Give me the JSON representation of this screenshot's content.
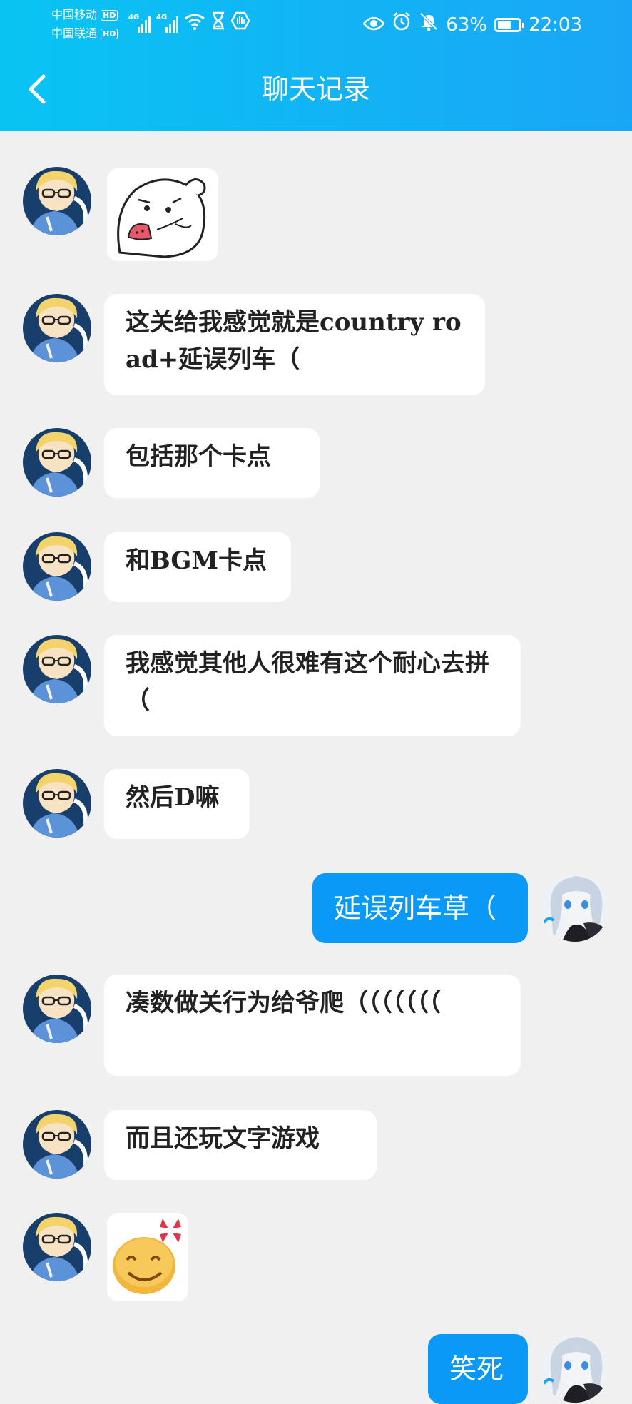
{
  "status_bar": {
    "carrier_1": "中国移动",
    "carrier_2": "中国联通",
    "hd_label": "HD",
    "network_1": "4G",
    "network_2": "4G",
    "battery_percent": "63%",
    "battery_level": 0.63,
    "time": "22:03"
  },
  "header": {
    "title": "聊天记录"
  },
  "colors": {
    "header_gradient_start": "#09c4f3",
    "header_gradient_end": "#1aa6f6",
    "outgoing_bubble": "#0a99f7",
    "incoming_bubble": "#ffffff",
    "background": "#f0f0f0"
  },
  "messages": [
    {
      "side": "incoming",
      "type": "sticker",
      "sticker": "white-blob-eating-watermelon-sticker"
    },
    {
      "side": "incoming",
      "type": "text",
      "text": "这关给我感觉就是country road+延误列车（"
    },
    {
      "side": "incoming",
      "type": "text",
      "text": "包括那个卡点"
    },
    {
      "side": "incoming",
      "type": "text",
      "text": "和BGM卡点"
    },
    {
      "side": "incoming",
      "type": "text",
      "text": "我感觉其他人很难有这个耐心去拼（"
    },
    {
      "side": "incoming",
      "type": "text",
      "text": "然后D嘛"
    },
    {
      "side": "outgoing",
      "type": "text",
      "text": "延误列车草（"
    },
    {
      "side": "incoming",
      "type": "text",
      "text": "凑数做关行为给爷爬（（（（（（（"
    },
    {
      "side": "incoming",
      "type": "text",
      "text": "而且还玩文字游戏"
    },
    {
      "side": "incoming",
      "type": "sticker",
      "sticker": "angry-smiley-face-sticker"
    },
    {
      "side": "outgoing",
      "type": "text",
      "text": "笑死"
    }
  ]
}
